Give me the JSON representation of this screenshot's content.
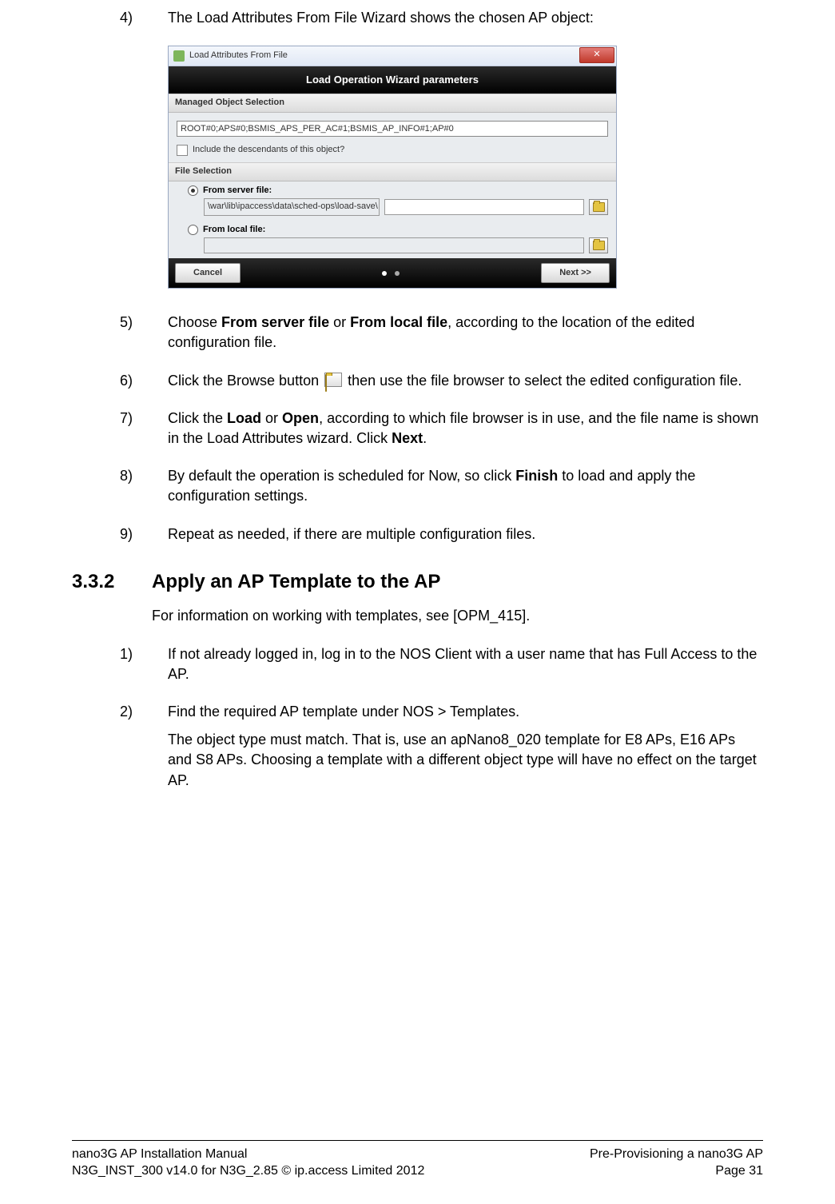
{
  "steps_a": {
    "s4": {
      "num": "4)",
      "text": "The Load Attributes From File Wizard shows the chosen AP object:"
    },
    "s5": {
      "num": "5)",
      "pre": "Choose ",
      "b1": "From server file",
      "mid": " or ",
      "b2": "From local file",
      "post": ", according to the location of the edited configuration file."
    },
    "s6": {
      "num": "6)",
      "pre": "Click the Browse button ",
      "post": " then use the file browser to select the edited configuration file."
    },
    "s7": {
      "num": "7)",
      "pre": "Click the ",
      "b1": "Load",
      "mid": " or ",
      "b2": "Open",
      "post1": ", according to which file browser is in use, and the file name is shown in the Load Attributes wizard. Click ",
      "b3": "Next",
      "post2": "."
    },
    "s8": {
      "num": "8)",
      "pre": "By default the operation is scheduled for Now, so click ",
      "b1": "Finish",
      "post": " to load and apply the configuration settings."
    },
    "s9": {
      "num": "9)",
      "text": "Repeat as needed, if there are multiple configuration files."
    }
  },
  "section": {
    "num": "3.3.2",
    "title": "Apply an AP Template to the AP",
    "intro": "For information on working with templates, see [OPM_415]."
  },
  "steps_b": {
    "s1": {
      "num": "1)",
      "text": "If not already logged in, log in to the NOS Client with a user name that has Full Access to the AP."
    },
    "s2": {
      "num": "2)",
      "text": "Find the required AP template under NOS > Templates.",
      "note": "The object type must match. That is, use an apNano8_020 template for E8 APs, E16 APs and S8 APs. Choosing a template with a different object type will have no effect on the target AP."
    }
  },
  "wizard": {
    "window_title": "Load Attributes From File",
    "close_glyph": "✕",
    "header": "Load Operation Wizard parameters",
    "sec_managed": "Managed Object Selection",
    "object_path": "ROOT#0;APS#0;BSMIS_APS_PER_AC#1;BSMIS_AP_INFO#1;AP#0",
    "include_desc": "Include the descendants of this object?",
    "sec_file": "File Selection",
    "from_server": "From server file:",
    "server_path": "\\war\\lib\\ipaccess\\data\\sched-ops\\load-save\\",
    "from_local": "From local file:",
    "cancel": "Cancel",
    "next": "Next >>"
  },
  "footer": {
    "left1": "nano3G AP Installation Manual",
    "left2": "N3G_INST_300 v14.0 for N3G_2.85 © ip.access Limited 2012",
    "right1": "Pre-Provisioning a nano3G AP",
    "right2": "Page 31"
  }
}
